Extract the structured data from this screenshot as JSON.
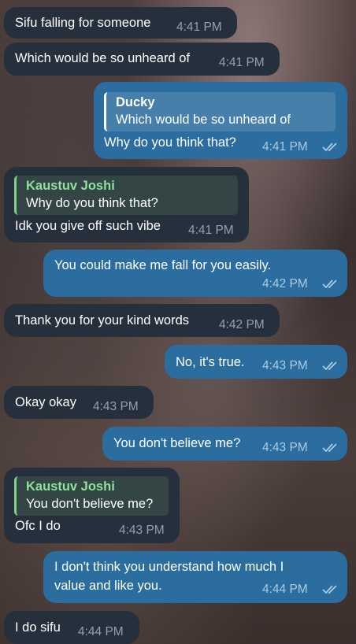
{
  "messages": [
    {
      "text": "Sifu falling for someone",
      "time": "4:41 PM"
    },
    {
      "text": "Which would be so unheard of",
      "time": "4:41 PM"
    },
    {
      "reply_name": "Ducky",
      "reply_text": "Which would be so unheard of",
      "text": "Why do you think that?",
      "time": "4:41 PM"
    },
    {
      "reply_name": "Kaustuv Joshi",
      "reply_text": "Why do you think that?",
      "text": "Idk you give off such vibe",
      "time": "4:41 PM"
    },
    {
      "text": "You could make me fall for you easily.",
      "time": "4:42 PM"
    },
    {
      "text": "Thank you for your kind words",
      "time": "4:42 PM"
    },
    {
      "text": "No, it's true.",
      "time": "4:43 PM"
    },
    {
      "text": "Okay okay",
      "time": "4:43 PM"
    },
    {
      "text": "You don't believe me?",
      "time": "4:43 PM"
    },
    {
      "reply_name": "Kaustuv Joshi",
      "reply_text": "You don't believe me?",
      "text": "Ofc I do",
      "time": "4:43 PM"
    },
    {
      "line1": "I don't think you understand how much I",
      "line2": "value and like you.",
      "time": "4:44 PM"
    },
    {
      "text": "I do sifu",
      "time": "4:44 PM"
    }
  ],
  "icons": {
    "read_receipt": "double-check-icon"
  },
  "colors": {
    "incoming_bubble": "#26303c",
    "outgoing_bubble": "#2b6d9e",
    "quote_name_incoming": "#8ee29a"
  }
}
